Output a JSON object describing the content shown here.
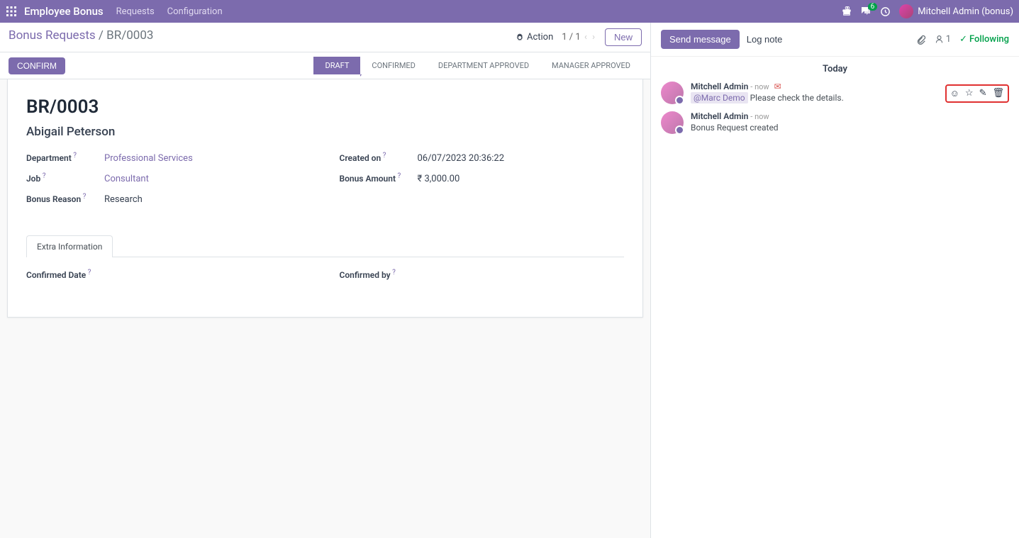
{
  "topbar": {
    "brand": "Employee Bonus",
    "links": [
      "Requests",
      "Configuration"
    ],
    "msg_badge": "6",
    "user": "Mitchell Admin (bonus)"
  },
  "breadcrumb": {
    "root": "Bonus Requests",
    "current": "BR/0003"
  },
  "controls": {
    "action": "Action",
    "pager": "1 / 1",
    "new": "New"
  },
  "statusbar": {
    "confirm": "CONFIRM",
    "steps": [
      "DRAFT",
      "CONFIRMED",
      "DEPARTMENT APPROVED",
      "MANAGER APPROVED"
    ]
  },
  "record": {
    "title": "BR/0003",
    "employee": "Abigail Peterson",
    "fields_left": {
      "department_label": "Department",
      "department_value": "Professional Services",
      "job_label": "Job",
      "job_value": "Consultant",
      "reason_label": "Bonus Reason",
      "reason_value": "Research"
    },
    "fields_right": {
      "created_label": "Created on",
      "created_value": "06/07/2023 20:36:22",
      "amount_label": "Bonus Amount",
      "amount_value": "₹ 3,000.00"
    },
    "tab": "Extra Information",
    "extra": {
      "confirmed_date_label": "Confirmed Date",
      "confirmed_by_label": "Confirmed by"
    }
  },
  "chatter": {
    "send": "Send message",
    "log": "Log note",
    "follower_count": "1",
    "following": "Following",
    "date": "Today",
    "messages": [
      {
        "author": "Mitchell Admin",
        "time": "now",
        "mention": "@Marc Demo",
        "text": " Please check the details.",
        "has_envelope": true
      },
      {
        "author": "Mitchell Admin",
        "time": "now",
        "text": "Bonus Request created",
        "has_envelope": false
      }
    ]
  }
}
